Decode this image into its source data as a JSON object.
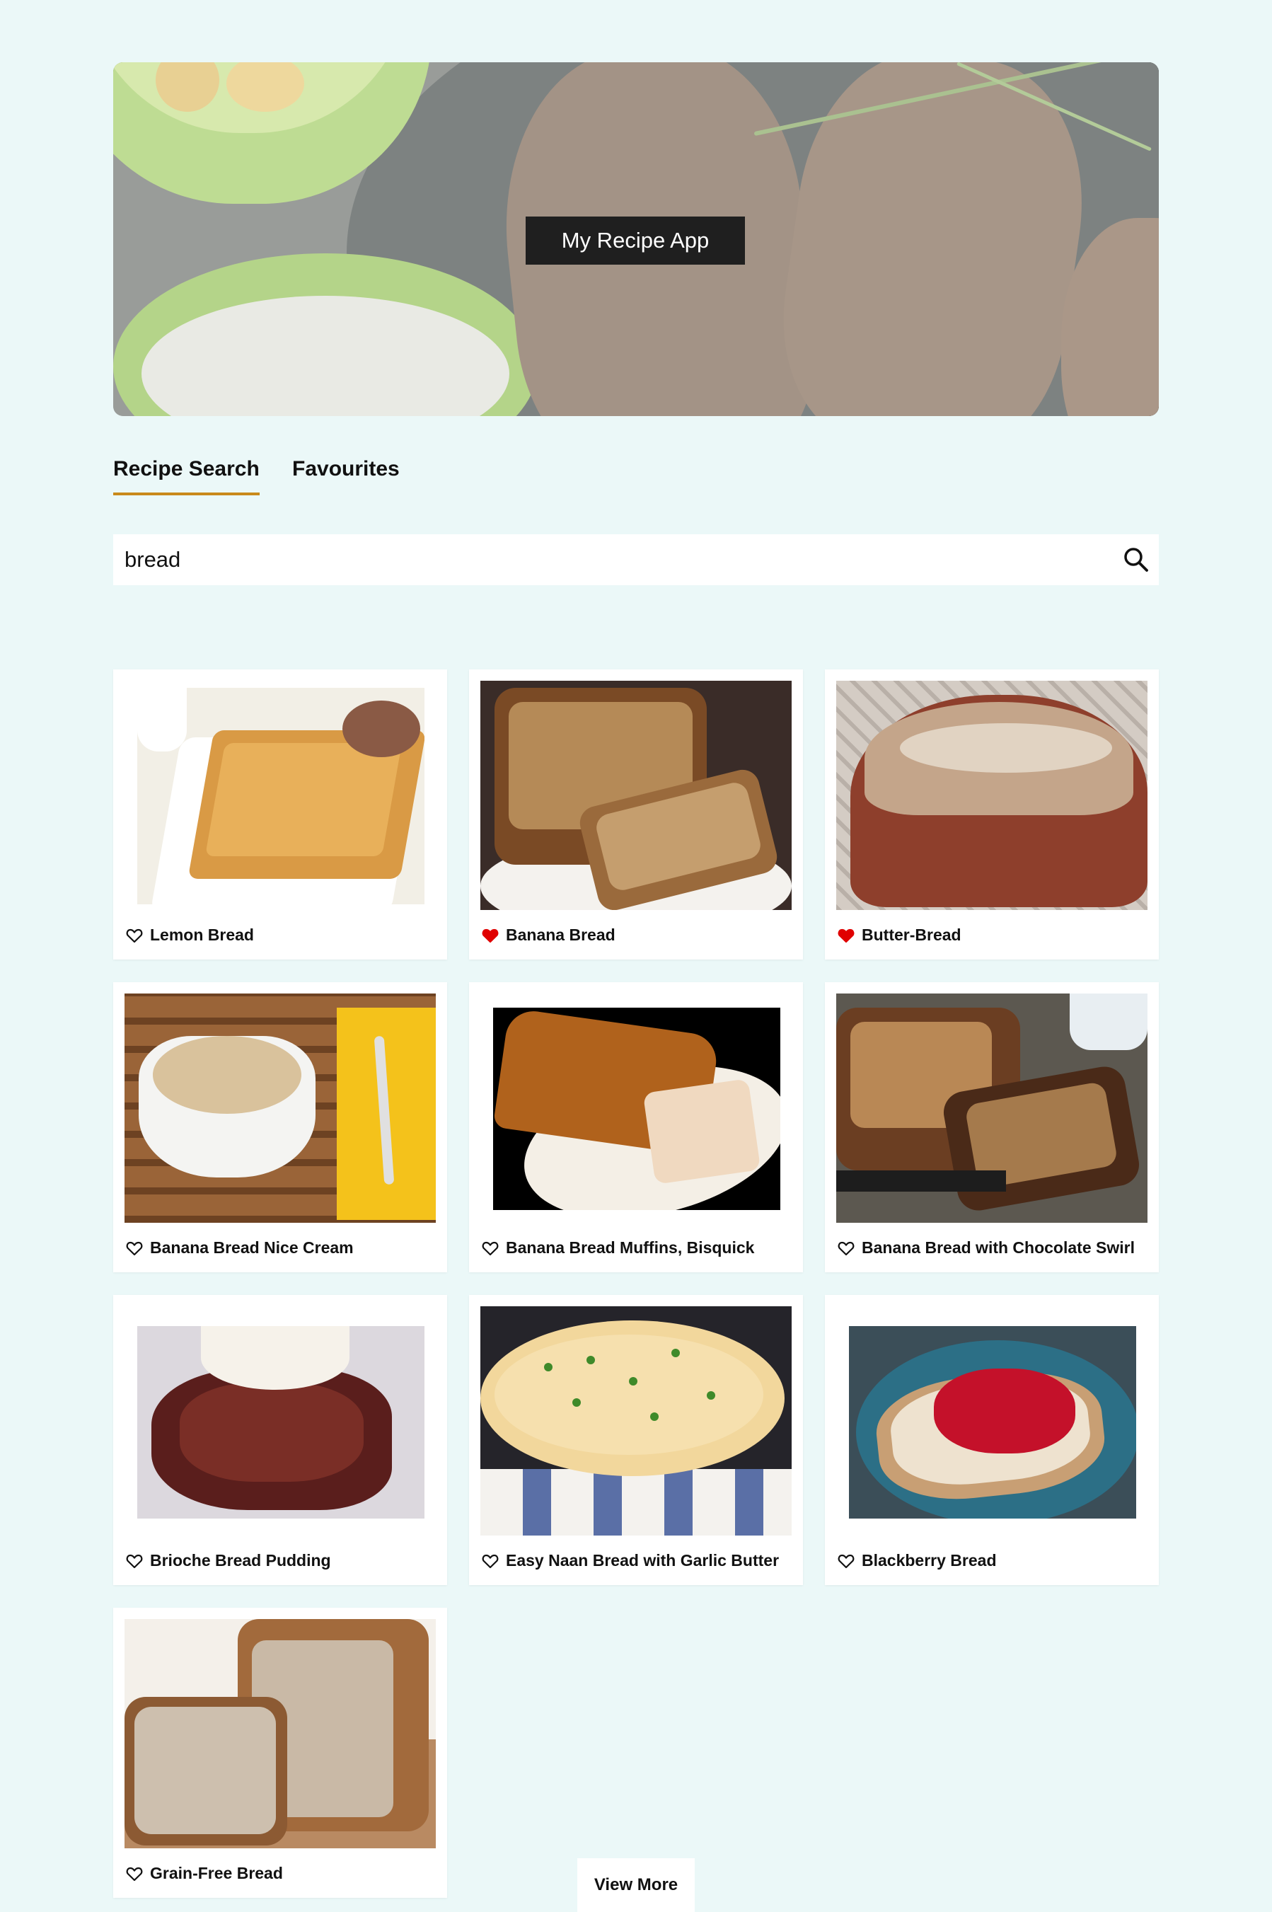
{
  "header": {
    "title": "My Recipe App"
  },
  "tabs": [
    {
      "label": "Recipe Search",
      "active": true
    },
    {
      "label": "Favourites",
      "active": false
    }
  ],
  "search": {
    "value": "bread",
    "icon": "search-icon"
  },
  "recipes": [
    {
      "title": "Lemon Bread",
      "favourite": false
    },
    {
      "title": "Banana Bread",
      "favourite": true
    },
    {
      "title": "Butter-Bread",
      "favourite": true
    },
    {
      "title": "Banana Bread Nice Cream",
      "favourite": false
    },
    {
      "title": "Banana Bread Muffins, Bisquick",
      "favourite": false
    },
    {
      "title": "Banana Bread with Chocolate Swirl",
      "favourite": false
    },
    {
      "title": "Brioche Bread Pudding",
      "favourite": false
    },
    {
      "title": "Easy Naan Bread with Garlic Butter",
      "favourite": false
    },
    {
      "title": "Blackberry Bread",
      "favourite": false
    },
    {
      "title": "Grain-Free Bread",
      "favourite": false
    }
  ],
  "view_more": {
    "label": "View More"
  },
  "colors": {
    "background": "#ebf8f8",
    "tab_underline": "#c98a1b",
    "heart_filled": "#e00000",
    "title_box": "#1f1f1f"
  }
}
